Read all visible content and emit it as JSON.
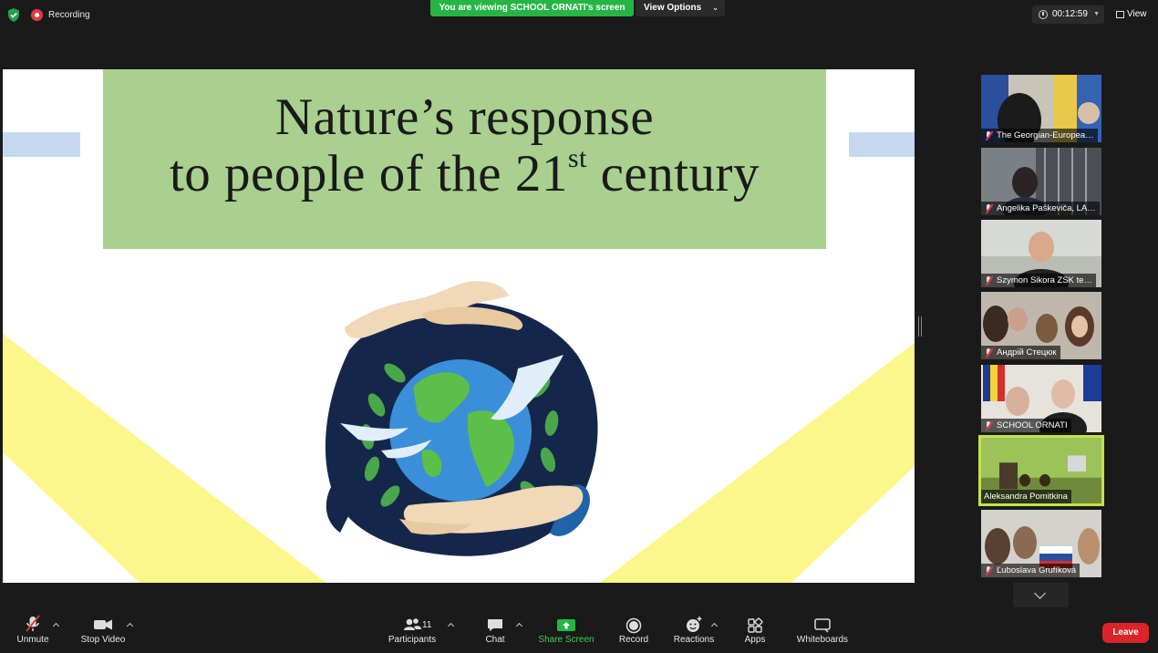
{
  "status": {
    "recording_label": "Recording",
    "viewing_banner": "You are viewing SCHOOL ORNATI's screen",
    "view_options_label": "View Options",
    "timer": "00:12:59",
    "view_label": "View"
  },
  "slide": {
    "title_line1": "Nature’s response",
    "title_line2_pre": "to people of the 21",
    "title_line2_sup": "st",
    "title_line2_post": " century"
  },
  "participants": [
    {
      "name": "The Georgian-Europea…",
      "muted": true
    },
    {
      "name": "Angelika Paškeviča, LA…",
      "muted": true
    },
    {
      "name": "Szymon Sikora ZSK te…",
      "muted": true
    },
    {
      "name": "Андрій Стецюк",
      "muted": true
    },
    {
      "name": "SCHOOL ORNATI",
      "muted": true
    },
    {
      "name": "Aleksandra Pomitkina",
      "muted": false,
      "active_speaker": true
    },
    {
      "name": "Ľuboslava Grufíková",
      "muted": true
    }
  ],
  "toolbar": {
    "unmute": "Unmute",
    "stop_video": "Stop Video",
    "participants": "Participants",
    "participants_count": "11",
    "chat": "Chat",
    "share_screen": "Share Screen",
    "record": "Record",
    "reactions": "Reactions",
    "apps": "Apps",
    "whiteboards": "Whiteboards",
    "leave": "Leave"
  },
  "colors": {
    "share_green": "#26b545",
    "leave_red": "#d9252a",
    "title_green": "#a9d08f",
    "slide_yellow": "#fdf68a",
    "slide_blue": "#c5d8f0",
    "active_border": "#c7e04a"
  }
}
